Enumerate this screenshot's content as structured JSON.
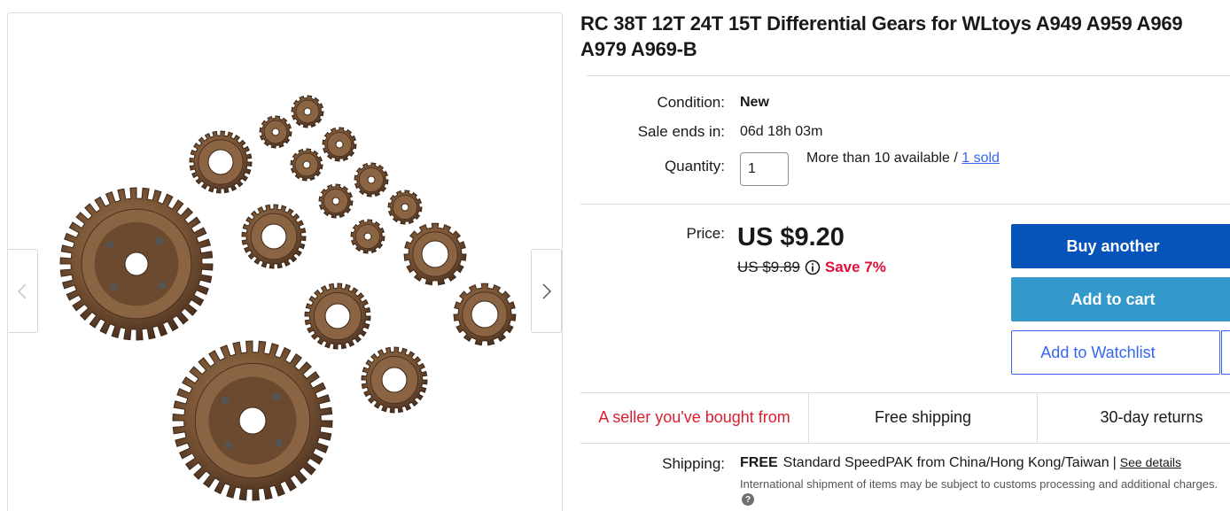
{
  "gallery": {
    "image_alt": "gears-photo-icon",
    "prev_icon": "chevron-left-icon",
    "next_icon": "chevron-right-icon"
  },
  "listing": {
    "title": "RC 38T 12T 24T 15T Differential Gears for WLtoys A949 A959 A969 A979 A969-B",
    "condition_label": "Condition:",
    "condition_value": "New",
    "sale_ends_label": "Sale ends in:",
    "sale_ends_value": "06d 18h 03m",
    "quantity_label": "Quantity:",
    "quantity_value": "1",
    "availability_text": "More than 10 available / ",
    "sold_link": "1 sold"
  },
  "pricing": {
    "price_label": "Price:",
    "price": "US $9.20",
    "was_price": "US $9.89",
    "save_text": "Save 7%",
    "info_icon": "info-icon"
  },
  "actions": {
    "buy_label": "Buy another",
    "cart_label": "Add to cart",
    "watch_label": "Add to Watchlist"
  },
  "highlights": [
    {
      "label": "A seller you've bought from"
    },
    {
      "label": "Free shipping"
    },
    {
      "label": "30-day returns"
    }
  ],
  "shipping": {
    "label": "Shipping:",
    "free": "FREE",
    "service": "Standard SpeedPAK from China/Hong Kong/Taiwan",
    "separator": "|",
    "details_link": "See details",
    "note": "International shipment of items may be subject to customs processing and additional charges.",
    "help_icon": "?"
  },
  "colors": {
    "buy_button": "#0654ba",
    "cart_button": "#3498ca",
    "watch_border": "#3665f3",
    "save_red": "#e0103a",
    "seller_red": "#dd1e31"
  }
}
